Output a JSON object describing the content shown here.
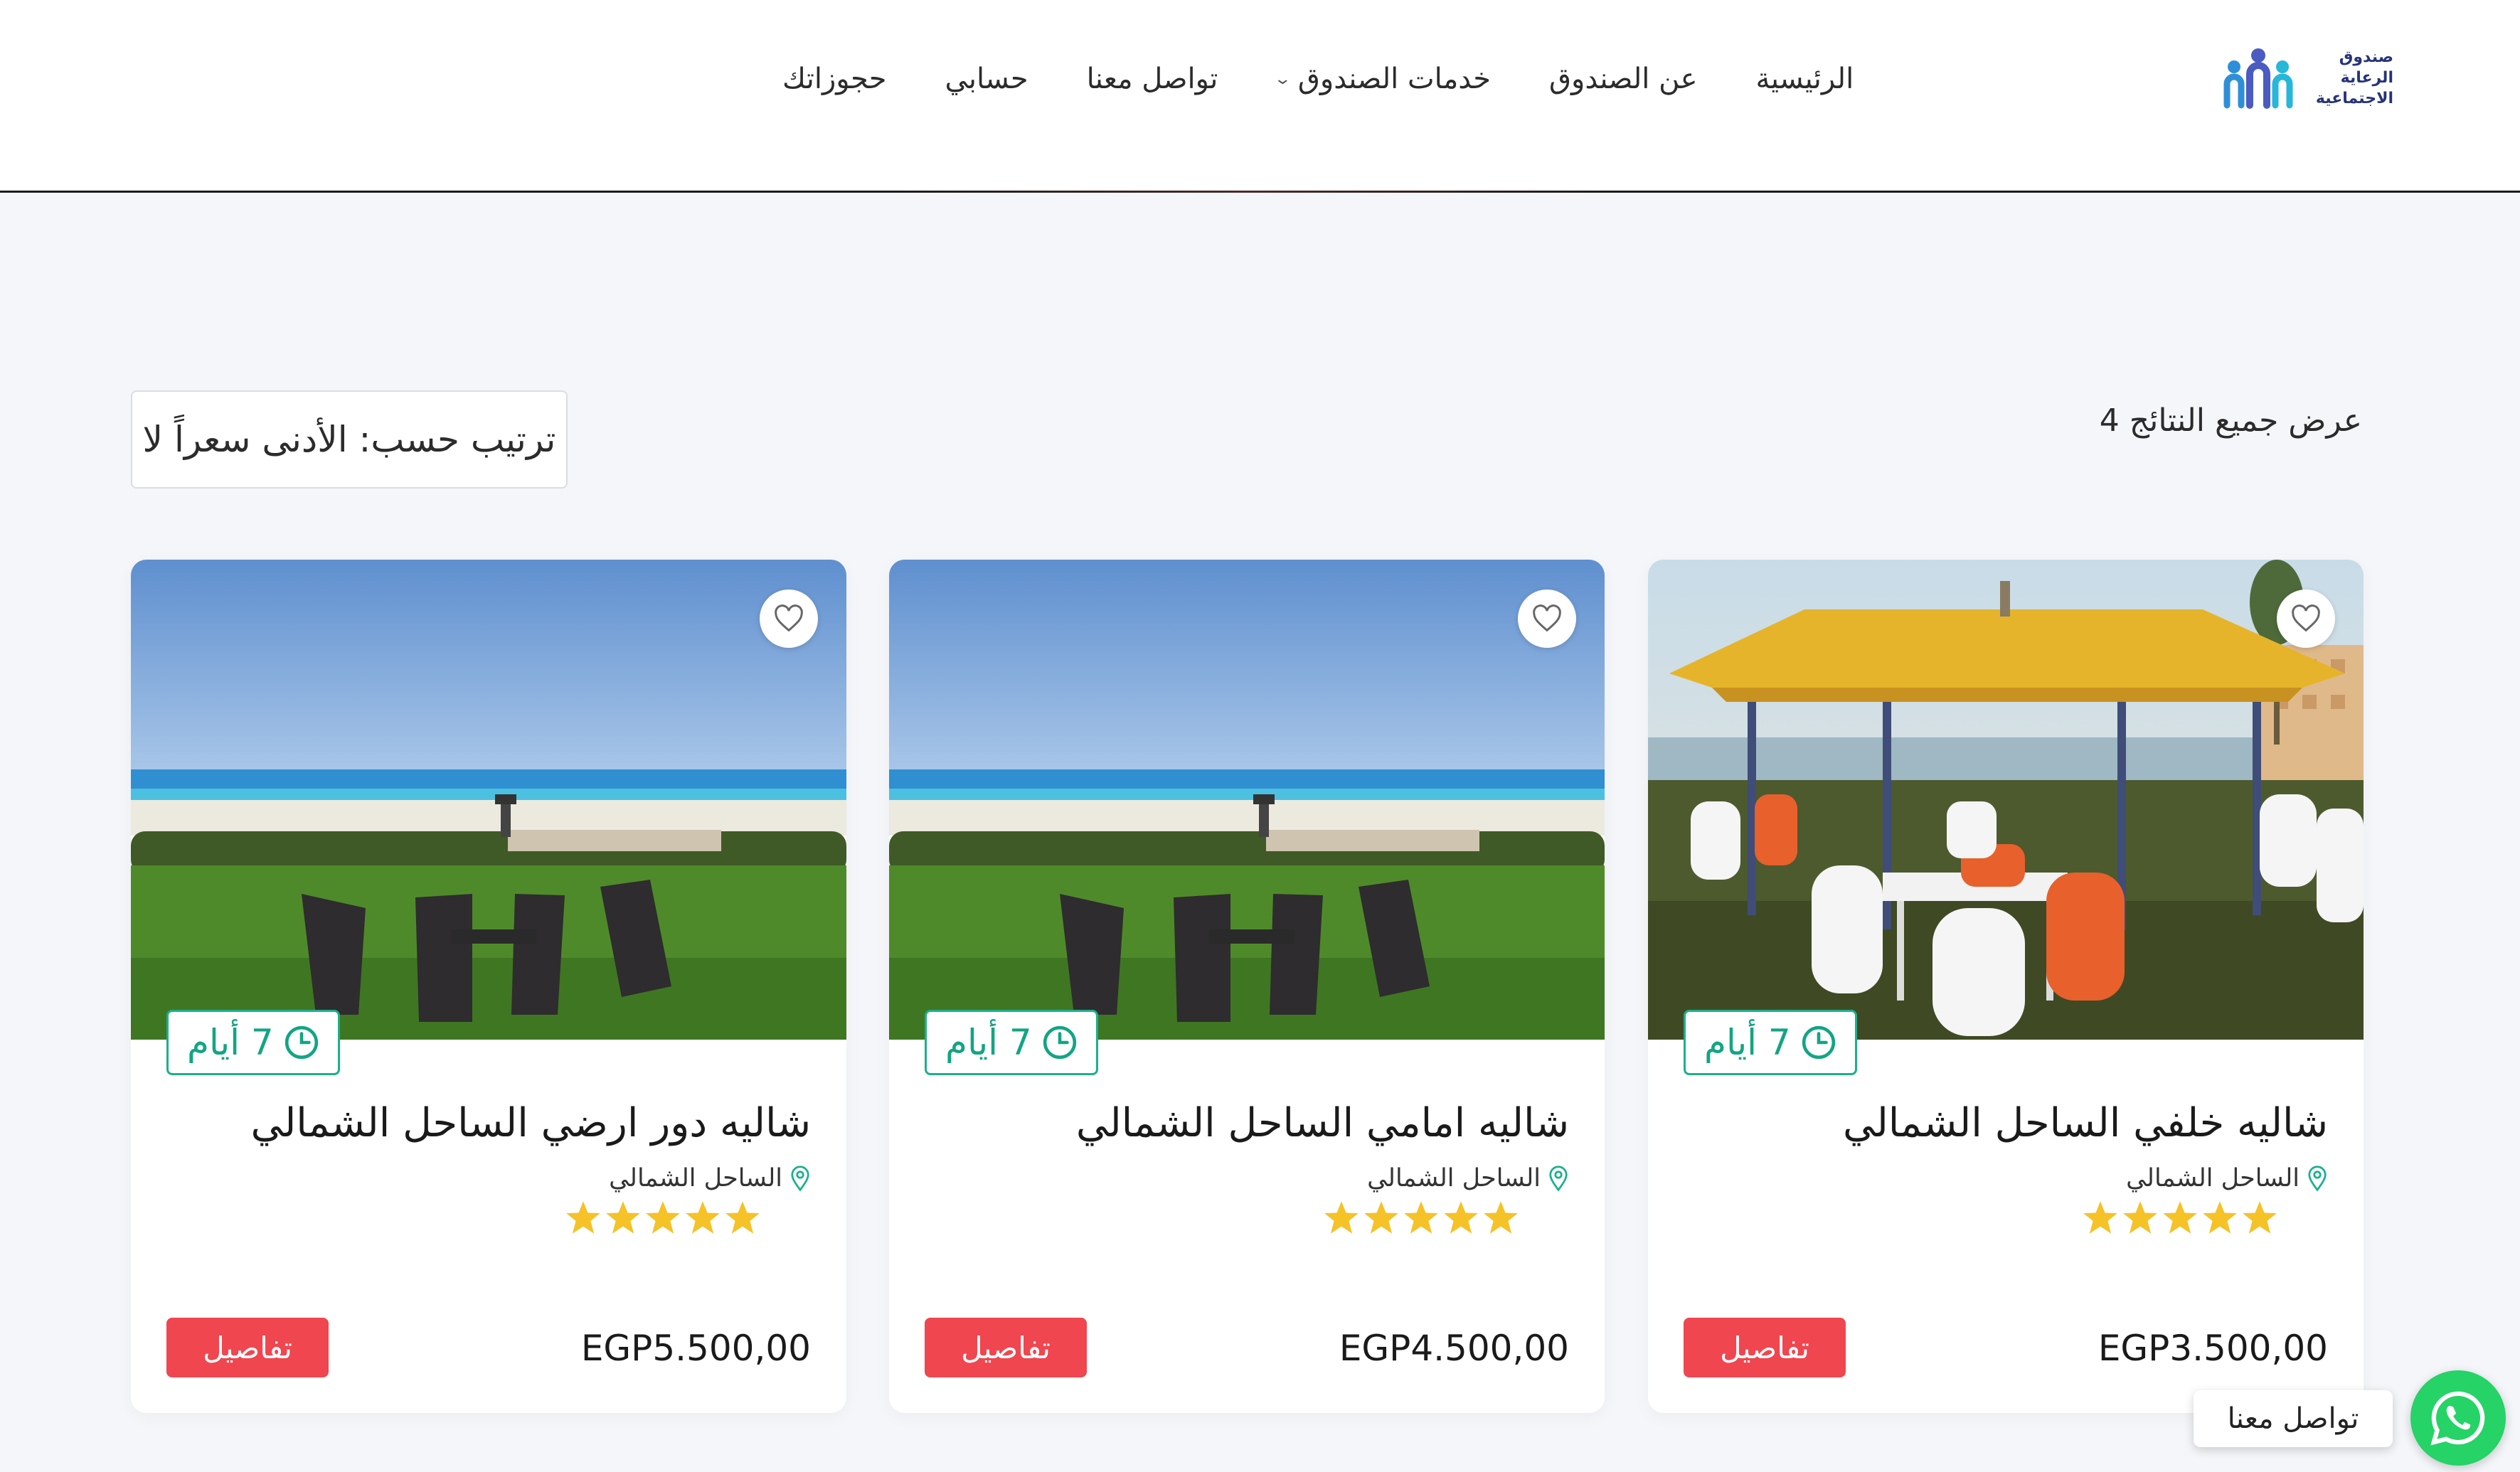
{
  "header": {
    "logo_text": [
      "صندوق",
      "الرعاية",
      "الاجتماعية"
    ],
    "nav": [
      {
        "label": "الرئيسية"
      },
      {
        "label": "عن الصندوق"
      },
      {
        "label": "خدمات الصندوق",
        "has_dropdown": true
      },
      {
        "label": "تواصل معنا"
      },
      {
        "label": "حسابي"
      },
      {
        "label": "حجوزاتك"
      }
    ]
  },
  "toolbar": {
    "results_text": "عرض جميع النتائج 4",
    "sort_label": "ترتيب حسب: الأدنى سعراً لا"
  },
  "cards": [
    {
      "title": "شاليه خلفي الساحل الشمالي",
      "location": "الساحل الشمالي",
      "duration": "7 أيام",
      "rating": 5,
      "price": "EGP3.500,00",
      "button": "تفاصيل",
      "image": "gazebo-with-plastic-chairs"
    },
    {
      "title": "شاليه امامي الساحل الشمالي",
      "location": "الساحل الشمالي",
      "duration": "7 أيام",
      "rating": 5,
      "price": "EGP4.500,00",
      "button": "تفاصيل",
      "image": "beach-lawn-wicker-chairs"
    },
    {
      "title": "شاليه دور ارضي الساحل الشمالي",
      "location": "الساحل الشمالي",
      "duration": "7 أيام",
      "rating": 5,
      "price": "EGP5.500,00",
      "button": "تفاصيل",
      "image": "beach-lawn-wicker-chairs"
    }
  ],
  "whatsapp": {
    "label": "تواصل معنا"
  },
  "colors": {
    "accent_green": "#1bb08d",
    "button_red": "#f0464f",
    "star_yellow": "#f5c227",
    "whatsapp_green": "#25d366",
    "logo_navy": "#26337a"
  },
  "icons": {
    "favorite": "heart-icon",
    "duration": "clock-icon",
    "location": "map-pin-icon",
    "rating": "star-icon",
    "chat": "whatsapp-icon",
    "dropdown": "chevron-down-icon"
  }
}
